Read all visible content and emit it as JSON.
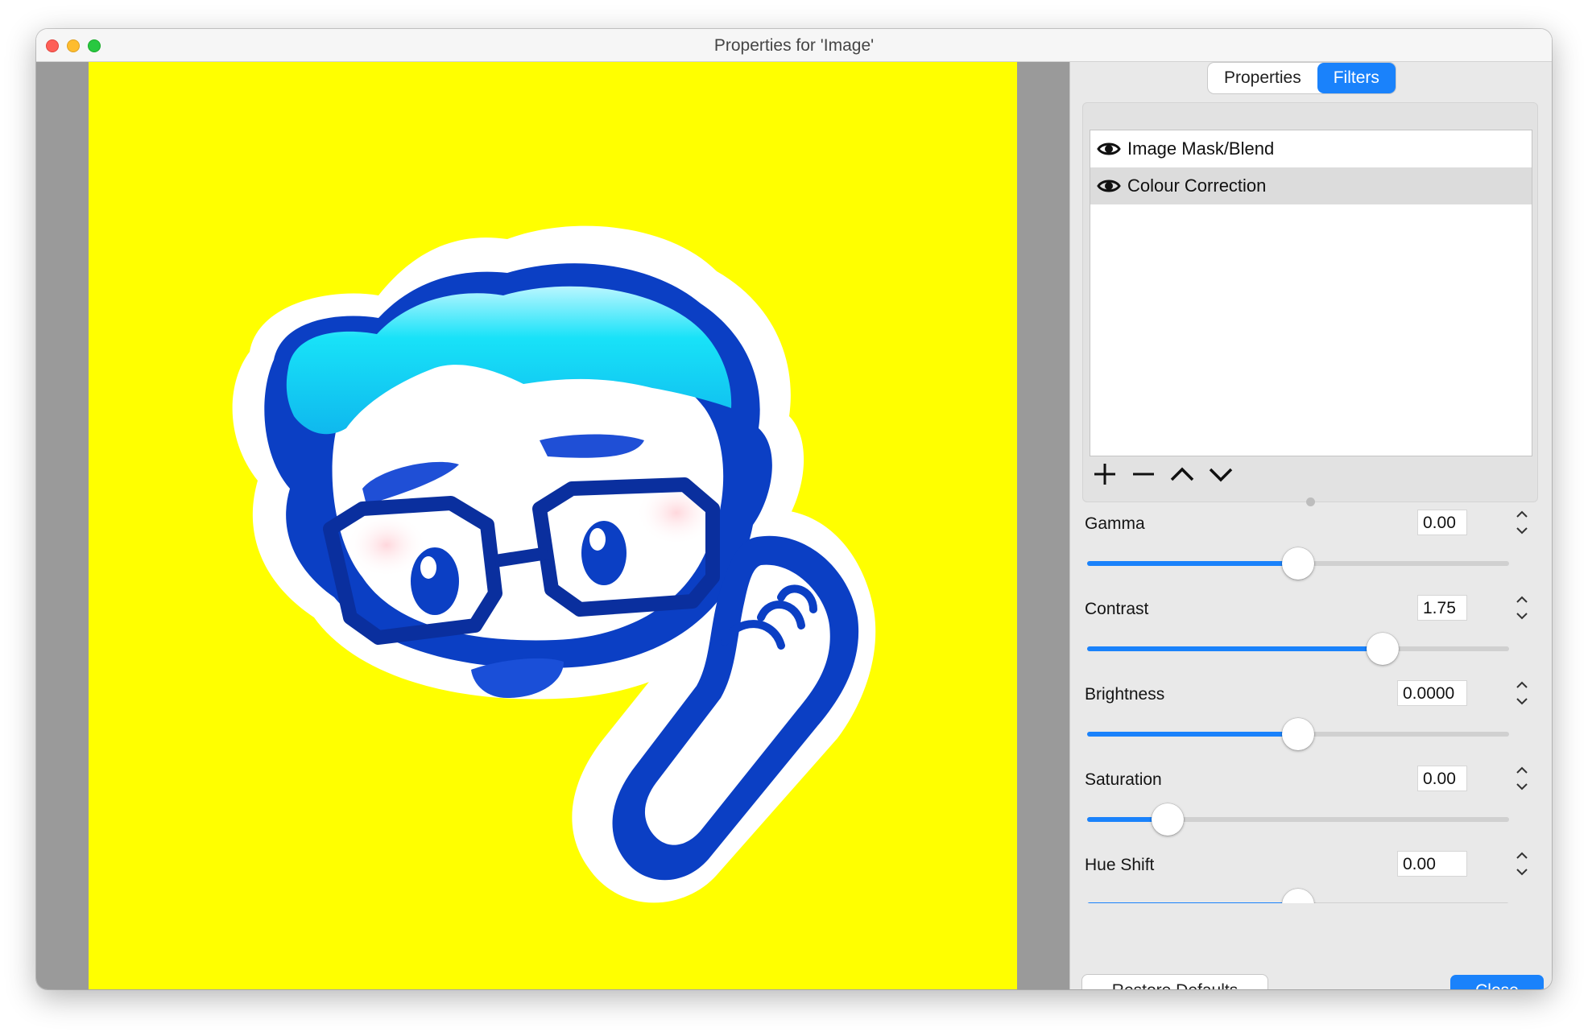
{
  "window": {
    "title": "Properties for 'Image'"
  },
  "tabs": [
    {
      "label": "Properties",
      "active": false
    },
    {
      "label": "Filters",
      "active": true
    }
  ],
  "filters": [
    {
      "name": "Image Mask/Blend",
      "visible": true,
      "selected": false,
      "icon": "eye-icon"
    },
    {
      "name": "Colour Correction",
      "visible": true,
      "selected": true,
      "icon": "eye-icon"
    }
  ],
  "list_buttons": [
    "plus-icon",
    "minus-icon",
    "chevron-up-icon",
    "chevron-down-icon"
  ],
  "sliders": [
    {
      "label": "Gamma",
      "value": "0.00",
      "fraction": 0.5
    },
    {
      "label": "Contrast",
      "value": "1.75",
      "fraction": 0.7
    },
    {
      "label": "Brightness",
      "value": "0.0000",
      "fraction": 0.5
    },
    {
      "label": "Saturation",
      "value": "0.00",
      "fraction": 0.19
    },
    {
      "label": "Hue Shift",
      "value": "0.00",
      "fraction": 0.5
    }
  ],
  "buttons": {
    "restore": "Restore Defaults",
    "close": "Close"
  },
  "colors": {
    "accent": "#1a82fb",
    "canvas_bg": "#ffff00",
    "mascot_outline": "#0b3fc4",
    "mascot_hair": "#16dcf4"
  }
}
